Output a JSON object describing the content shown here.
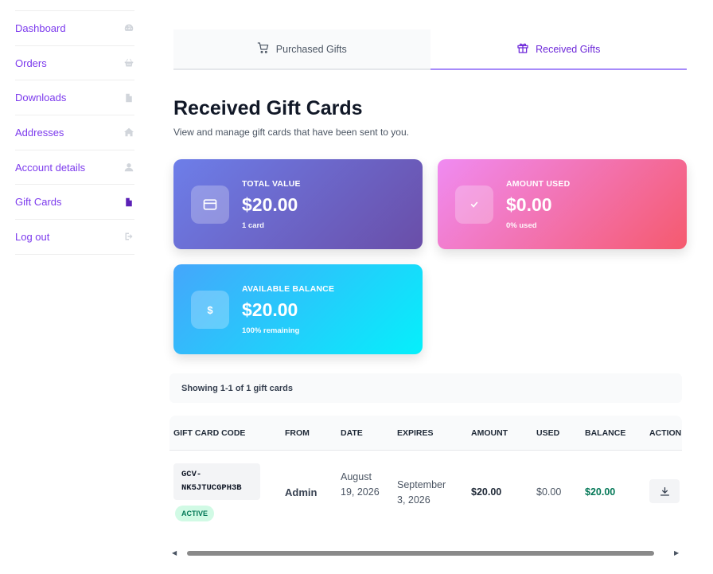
{
  "sidebar": {
    "items": [
      {
        "label": "Dashboard",
        "icon": "dashboard-icon"
      },
      {
        "label": "Orders",
        "icon": "basket-icon"
      },
      {
        "label": "Downloads",
        "icon": "file-icon"
      },
      {
        "label": "Addresses",
        "icon": "home-icon"
      },
      {
        "label": "Account details",
        "icon": "user-icon"
      },
      {
        "label": "Gift Cards",
        "icon": "file-icon",
        "active": true
      },
      {
        "label": "Log out",
        "icon": "logout-icon"
      }
    ]
  },
  "tabs": {
    "purchased": "Purchased Gifts",
    "received": "Received Gifts",
    "active": "received"
  },
  "header": {
    "title": "Received Gift Cards",
    "subtitle": "View and manage gift cards that have been sent to you."
  },
  "stats": {
    "total": {
      "label": "TOTAL VALUE",
      "value": "$20.00",
      "note": "1 card",
      "icon": "credit-card-icon"
    },
    "used": {
      "label": "AMOUNT USED",
      "value": "$0.00",
      "note": "0% used",
      "icon": "check-icon"
    },
    "available": {
      "label": "AVAILABLE BALANCE",
      "value": "$20.00",
      "note": "100% remaining",
      "icon_text": "$"
    }
  },
  "showing": "Showing 1-1 of 1 gift cards",
  "table": {
    "columns": [
      "GIFT CARD CODE",
      "FROM",
      "DATE",
      "EXPIRES",
      "AMOUNT",
      "USED",
      "BALANCE",
      "ACTION"
    ],
    "rows": [
      {
        "code_line1": "GCV-",
        "code_line2": "NK5JTUCGPH3B",
        "status": "ACTIVE",
        "from": "Admin",
        "date": "August 19, 2026",
        "expires": "September 3, 2026",
        "amount": "$20.00",
        "used": "$0.00",
        "balance": "$20.00"
      }
    ]
  },
  "colors": {
    "accent": "#7c3aed",
    "success": "#047857"
  }
}
